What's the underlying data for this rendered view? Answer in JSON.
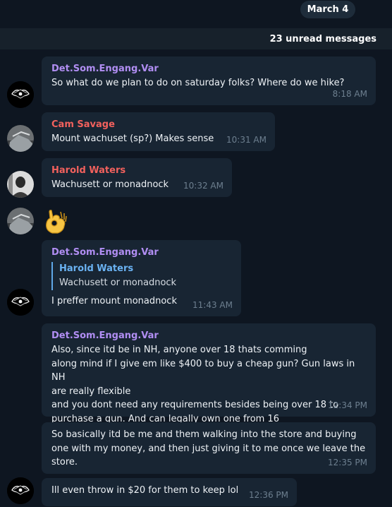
{
  "date_label": "March 4",
  "unread_label": "23 unread messages",
  "messages": [
    {
      "sender": "Det.Som.Engang.Var",
      "lines": [
        "So what do we plan to do on saturday folks? Where do we hike?"
      ],
      "time": "8:18 AM"
    },
    {
      "sender": "Cam Savage",
      "lines": [
        "Mount wachuset (sp?) Makes sense"
      ],
      "time": "10:31 AM"
    },
    {
      "sender": "Harold Waters",
      "lines": [
        "Wachusett or monadnock"
      ],
      "time": "10:32 AM"
    },
    {
      "emoji": "ok-hand-emoji"
    },
    {
      "sender": "Det.Som.Engang.Var",
      "reply": {
        "sender": "Harold Waters",
        "text": "Wachusett or monadnock"
      },
      "lines": [
        "I preffer mount monadnock"
      ],
      "time": "11:43 AM"
    },
    {
      "sender": "Det.Som.Engang.Var",
      "lines": [
        "Also, since itd be in NH, anyone over 18 thats comming",
        "along mind if I give em like $400 to buy a cheap gun? Gun laws in NH",
        "are really flexible",
        "and you dont need any requirements besides being over 18 to",
        "purchase a gun. And can legally own one from 16"
      ],
      "time": "12:34 PM"
    },
    {
      "lines": [
        "So basically itd be me and them walking into the store and buying",
        "one with my money, and then just giving it to me once we leave the",
        "store."
      ],
      "time": "12:35 PM"
    },
    {
      "lines": [
        "Ill even throw in $20 for them to keep lol"
      ],
      "time": "12:36 PM"
    }
  ],
  "colors": {
    "background": "#0e1621",
    "bubble": "#182533",
    "purple_name": "#b18ef3",
    "red_name": "#f2615d",
    "reply_name": "#6ab2f2"
  }
}
